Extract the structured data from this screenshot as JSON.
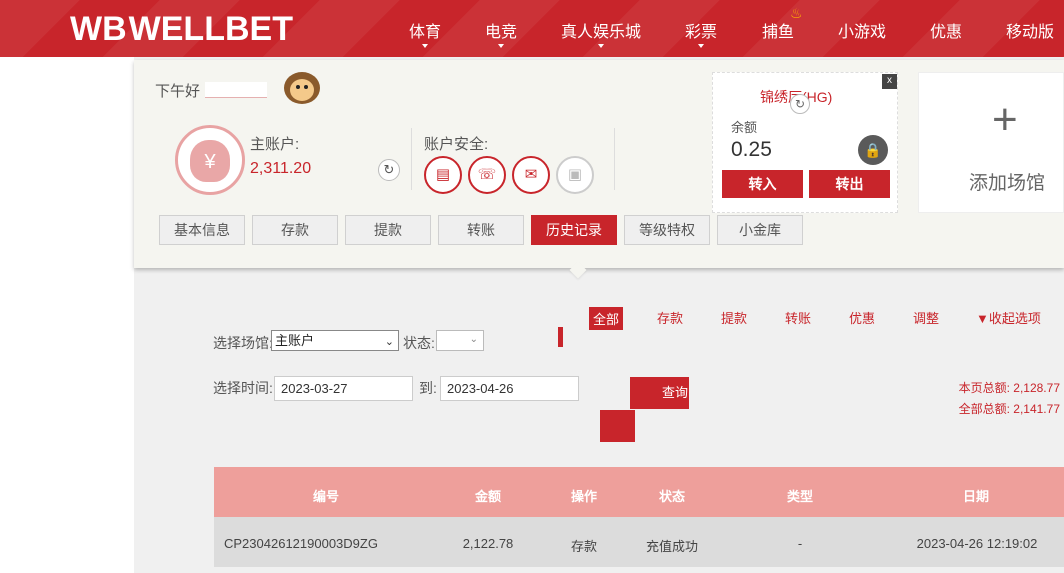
{
  "brand": {
    "logo_text": "WELLBET",
    "logo_mark": "WB"
  },
  "nav": {
    "items": [
      "体育",
      "电竞",
      "真人娱乐城",
      "彩票",
      "捕鱼",
      "小游戏",
      "优惠",
      "移动版"
    ]
  },
  "account": {
    "greeting": "下午好",
    "main_account_label": "主账户:",
    "main_balance": "2,311.20",
    "security_label": "账户安全:"
  },
  "tabs": [
    "基本信息",
    "存款",
    "提款",
    "转账",
    "历史记录",
    "等级特权",
    "小金库"
  ],
  "venue": {
    "name": "锦绣厅(HG)",
    "balance_label": "余额",
    "balance": "0.25",
    "transfer_in": "转入",
    "transfer_out": "转出",
    "close": "x"
  },
  "add_venue": {
    "label": "添加场馆",
    "plus": "+"
  },
  "filters": [
    "全部",
    "存款",
    "提款",
    "转账",
    "优惠",
    "调整"
  ],
  "collapse_label": "▼收起选项",
  "form": {
    "venue_label": "选择场馆:",
    "venue_value": "主账户",
    "status_label": "状态:",
    "time_label": "选择时间:",
    "date_from": "2023-03-27",
    "to_label": "到:",
    "date_to": "2023-04-26",
    "query_label": "查询"
  },
  "totals": {
    "page_total": "本页总额: 2,128.77",
    "all_total": "全部总额: 2,141.77"
  },
  "table": {
    "columns": [
      "编号",
      "金额",
      "操作",
      "状态",
      "类型",
      "日期"
    ],
    "rows": [
      [
        "CP23042612190003D9ZG",
        "2,122.78",
        "存款",
        "充值成功",
        "-",
        "2023-04-26 12:19:02"
      ]
    ]
  },
  "colors": {
    "brand_red": "#c8252b",
    "table_header": "#ee9f9b"
  }
}
